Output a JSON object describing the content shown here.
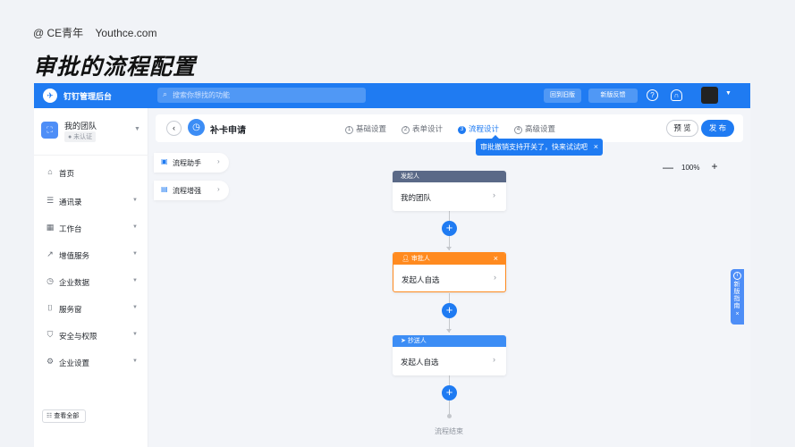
{
  "brand": {
    "at": "@ CE青年",
    "site": "Youthce.com"
  },
  "slide_title": "审批的流程配置",
  "topbar": {
    "app_name": "钉钉管理后台",
    "search_placeholder": "搜索你想找的功能",
    "old_version": "回到旧版",
    "new_feedback": "新版反馈",
    "help_icon": "?",
    "headset_icon": "∩"
  },
  "sidebar": {
    "team_name": "我的团队",
    "team_status": "● 未认证",
    "items": [
      {
        "icon": "⌂",
        "label": "首页",
        "has_caret": false
      },
      {
        "icon": "☰",
        "label": "通讯录",
        "has_caret": true
      },
      {
        "icon": "▦",
        "label": "工作台",
        "has_caret": true
      },
      {
        "icon": "↗",
        "label": "增值服务",
        "has_caret": true
      },
      {
        "icon": "◷",
        "label": "企业数据",
        "has_caret": true
      },
      {
        "icon": "⌷",
        "label": "服务窗",
        "has_caret": true
      },
      {
        "icon": "⛉",
        "label": "安全与权限",
        "has_caret": true
      },
      {
        "icon": "⚙",
        "label": "企业设置",
        "has_caret": true
      }
    ],
    "view_all": "查看全部"
  },
  "header": {
    "form_name": "补卡申请",
    "steps": [
      {
        "num": "1",
        "label": "基础设置",
        "active": false
      },
      {
        "num": "2",
        "label": "表单设计",
        "active": false
      },
      {
        "num": "3",
        "label": "流程设计",
        "active": true
      },
      {
        "num": "4",
        "label": "高级设置",
        "active": false
      }
    ],
    "preview": "预 览",
    "publish": "发 布"
  },
  "tooltip": {
    "text": "审批撤销支持开关了，快来试试吧",
    "close": "×"
  },
  "assist": [
    {
      "icon": "▣",
      "label": "流程助手"
    },
    {
      "icon": "▤",
      "label": "流程增强"
    }
  ],
  "zoom": {
    "minus": "—",
    "value": "100%",
    "plus": "+"
  },
  "flow": {
    "initiator": {
      "header": "发起人",
      "body": "我的团队"
    },
    "approver": {
      "header": "审批人",
      "body": "发起人自选",
      "close": "×"
    },
    "cc": {
      "header": "抄送人",
      "body": "发起人自选"
    },
    "end": "流程结束"
  },
  "guide": {
    "label": "新版指南",
    "close": "×"
  },
  "colors": {
    "primary": "#1f7bf2",
    "approver": "#ff8a1f",
    "initiator": "#5a6987",
    "cc": "#3c8df5"
  }
}
